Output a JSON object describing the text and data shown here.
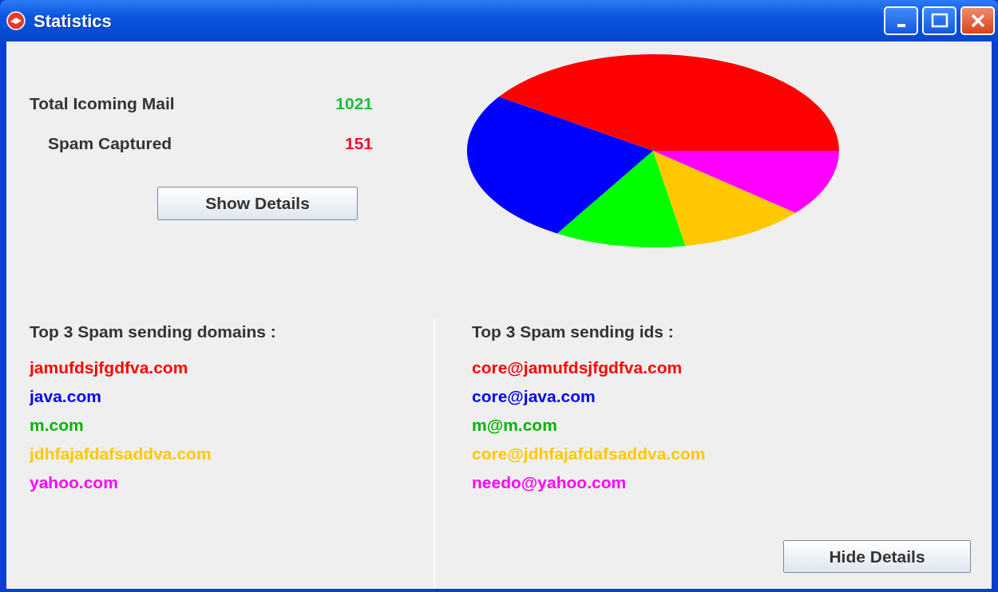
{
  "window": {
    "title": "Statistics"
  },
  "summary": [
    {
      "label": "Total Icoming Mail",
      "value": "1021",
      "color": "#1fbf3a"
    },
    {
      "label": "Spam Captured",
      "value": "151",
      "color": "#e8102c"
    }
  ],
  "show_button": "Show Details",
  "domains": {
    "heading": "Top 3 Spam sending domains :",
    "items": [
      {
        "text": "jamufdsjfgdfva.com",
        "color": "#ff0000"
      },
      {
        "text": "java.com",
        "color": "#0000ff"
      },
      {
        "text": "m.com",
        "color": "#00b400"
      },
      {
        "text": "jdhfajafdafsaddva.com",
        "color": "#ffc800"
      },
      {
        "text": "yahoo.com",
        "color": "#ff00ff"
      }
    ]
  },
  "ids": {
    "heading": "Top 3 Spam sending ids :",
    "items": [
      {
        "text": "core@jamufdsjfgdfva.com",
        "color": "#ff0000"
      },
      {
        "text": "core@java.com",
        "color": "#0000ff"
      },
      {
        "text": "m@m.com",
        "color": "#00b400"
      },
      {
        "text": "core@jdhfajafdafsaddva.com",
        "color": "#ffc800"
      },
      {
        "text": "needo@yahoo.com",
        "color": "#ff00ff"
      }
    ]
  },
  "hide_button": "Hide Details"
}
